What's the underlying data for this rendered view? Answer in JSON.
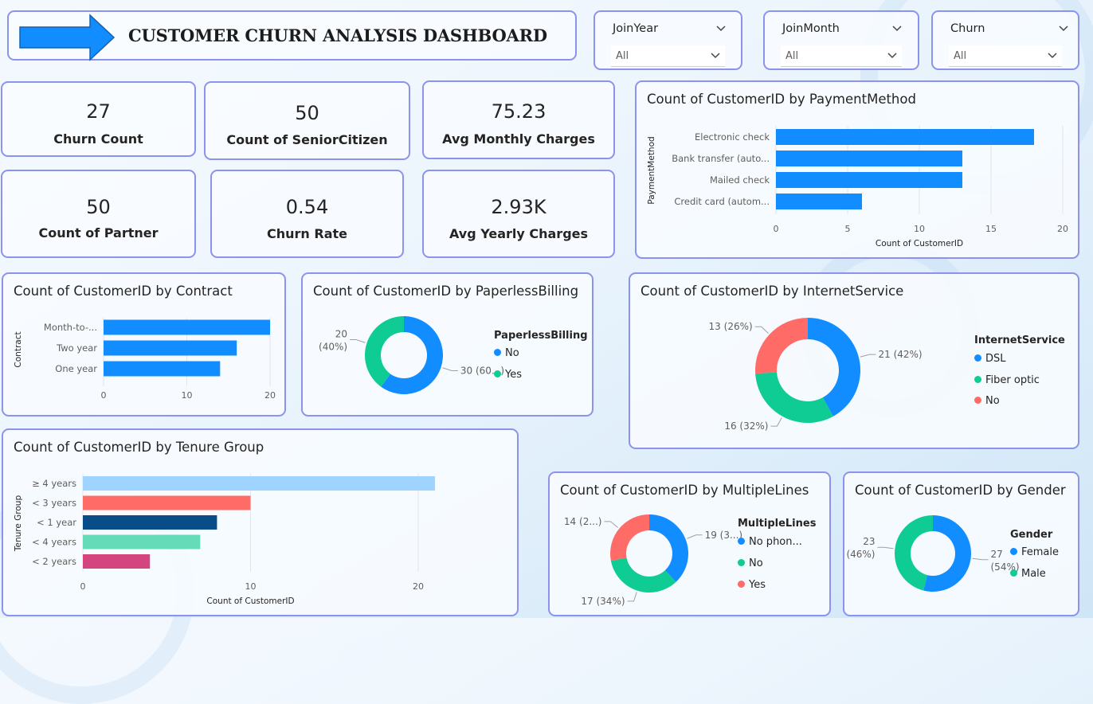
{
  "title": "CUSTOMER CHURN ANALYSIS DASHBOARD",
  "colors": {
    "blue": "#118DFF",
    "teal": "#0ECC93",
    "red": "#FF6B66",
    "card_border": "#8b93ee"
  },
  "slicers": [
    {
      "label": "JoinYear",
      "value": "All"
    },
    {
      "label": "JoinMonth",
      "value": "All"
    },
    {
      "label": "Churn",
      "value": "All"
    }
  ],
  "kpis": [
    {
      "value": "27",
      "label": "Churn Count"
    },
    {
      "value": "50",
      "label": "Count of SeniorCitizen"
    },
    {
      "value": "75.23",
      "label": "Avg Monthly Charges"
    },
    {
      "value": "50",
      "label": "Count of Partner"
    },
    {
      "value": "0.54",
      "label": "Churn Rate"
    },
    {
      "value": "2.93K",
      "label": "Avg Yearly Charges"
    }
  ],
  "chart_data": [
    {
      "type": "bar",
      "orientation": "horizontal",
      "title": "Count of CustomerID by PaymentMethod",
      "xlabel": "Count of CustomerID",
      "ylabel": "PaymentMethod",
      "categories": [
        "Electronic check",
        "Bank transfer (auto...",
        "Mailed check",
        "Credit card (autom..."
      ],
      "values": [
        18,
        13,
        13,
        6
      ],
      "xlim": [
        0,
        20
      ],
      "ticks": [
        "0",
        "5",
        "10",
        "15",
        "20"
      ],
      "color": "#118DFF"
    },
    {
      "type": "bar",
      "orientation": "horizontal",
      "title": "Count of CustomerID by Contract",
      "xlabel": "",
      "ylabel": "Contract",
      "categories": [
        "Month-to-...",
        "Two year",
        "One year"
      ],
      "values": [
        20,
        16,
        14
      ],
      "xlim": [
        0,
        20
      ],
      "ticks": [
        "0",
        "10",
        "20"
      ],
      "color": "#118DFF"
    },
    {
      "type": "pie",
      "donut": true,
      "title": "Count of CustomerID by PaperlessBilling",
      "legend_title": "PaperlessBilling",
      "slices": [
        {
          "name": "No",
          "value": 30,
          "label": "30 (60...)",
          "color": "#118DFF"
        },
        {
          "name": "Yes",
          "value": 20,
          "label": "20 (40%)",
          "color": "#0ECC93"
        }
      ]
    },
    {
      "type": "pie",
      "donut": true,
      "title": "Count of CustomerID by InternetService",
      "legend_title": "InternetService",
      "slices": [
        {
          "name": "DSL",
          "value": 21,
          "label": "21 (42%)",
          "color": "#118DFF"
        },
        {
          "name": "Fiber optic",
          "value": 16,
          "label": "16 (32%)",
          "color": "#0ECC93"
        },
        {
          "name": "No",
          "value": 13,
          "label": "13 (26%)",
          "color": "#FF6B66"
        }
      ]
    },
    {
      "type": "bar",
      "orientation": "horizontal",
      "title": "Count of CustomerID by Tenure Group",
      "xlabel": "Count of CustomerID",
      "ylabel": "Tenure Group",
      "categories": [
        "≥ 4 years",
        "< 3 years",
        "< 1 year",
        "< 4 years",
        "< 2 years"
      ],
      "values": [
        21,
        10,
        8,
        7,
        4
      ],
      "colors": [
        "#9ED4FF",
        "#FF6B66",
        "#084D88",
        "#66DBB8",
        "#D4447F"
      ],
      "xlim": [
        0,
        20
      ],
      "ticks": [
        "0",
        "10",
        "20"
      ]
    },
    {
      "type": "pie",
      "donut": true,
      "title": "Count of CustomerID by MultipleLines",
      "legend_title": "MultipleLines",
      "slices": [
        {
          "name": "No phon...",
          "value": 19,
          "label": "19 (3...)",
          "color": "#118DFF"
        },
        {
          "name": "No",
          "value": 17,
          "label": "17 (34%)",
          "color": "#0ECC93"
        },
        {
          "name": "Yes",
          "value": 14,
          "label": "14 (2...)",
          "color": "#FF6B66"
        }
      ]
    },
    {
      "type": "pie",
      "donut": true,
      "title": "Count of CustomerID by Gender",
      "legend_title": "Gender",
      "slices": [
        {
          "name": "Female",
          "value": 27,
          "label": "27 (54%)",
          "color": "#118DFF"
        },
        {
          "name": "Male",
          "value": 23,
          "label": "23 (46%)",
          "color": "#0ECC93"
        }
      ]
    }
  ]
}
